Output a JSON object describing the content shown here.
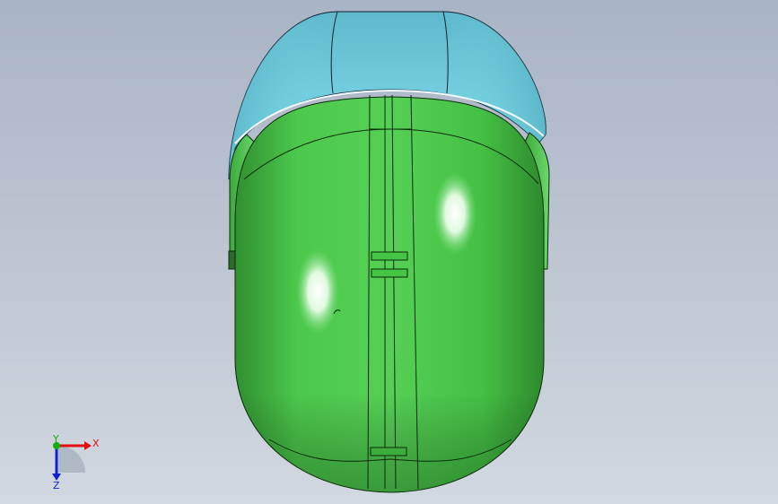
{
  "viewport": {
    "background_top": "#a9b4c5",
    "background_bottom": "#d2d8e0"
  },
  "model": {
    "visor_color": "#73cddd",
    "shell_color": "#3fbd3f",
    "edge_color": "#0b2a0b"
  },
  "triad": {
    "x_label": "X",
    "y_label": "Y",
    "z_label": "Z",
    "x_color": "#e01010",
    "y_color": "#10b010",
    "z_color": "#1020d0"
  }
}
